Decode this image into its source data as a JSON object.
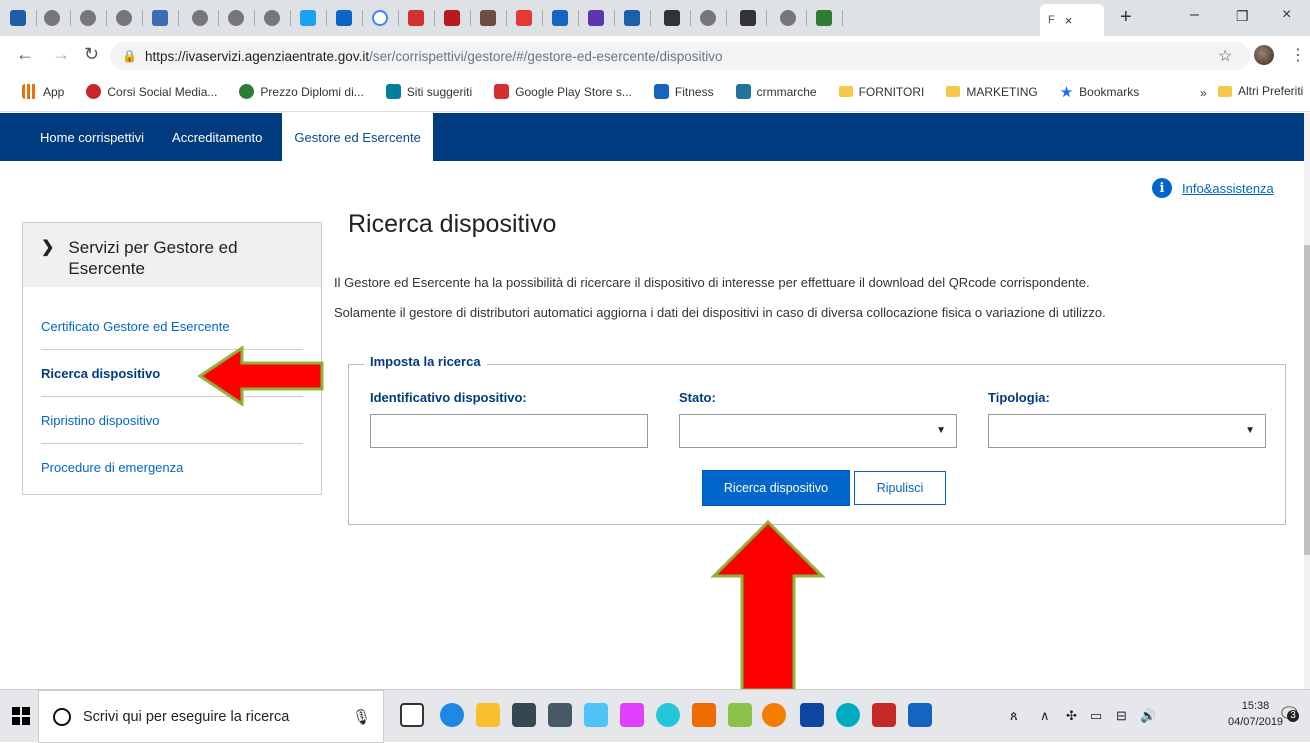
{
  "browser": {
    "active_tab_label": "F",
    "new_tab": "+",
    "window_controls": [
      "–",
      "❐",
      "×"
    ],
    "url_host": "https://ivaservizi.agenziaentrate.gov.it",
    "url_path": "/ser/corrispettivi/gestore/#/gestore-ed-esercente/dispositivo",
    "bookmarks": [
      {
        "label": "App",
        "icon": "apps-grid-icon",
        "color": "#e8710a"
      },
      {
        "label": "Corsi Social Media...",
        "icon": "bookmark-favicon-icon",
        "color": "#c62828"
      },
      {
        "label": "Prezzo Diplomi di...",
        "icon": "bookmark-favicon-icon",
        "color": "#2e7d32"
      },
      {
        "label": "Siti suggeriti",
        "icon": "bing-icon",
        "color": "#00809d"
      },
      {
        "label": "Google Play Store s...",
        "icon": "bookmark-favicon-icon",
        "color": "#d32f2f"
      },
      {
        "label": "Fitness",
        "icon": "cross-icon",
        "color": "#1565c0"
      },
      {
        "label": "crmmarche",
        "icon": "wp-icon",
        "color": "#21759b"
      },
      {
        "label": "FORNITORI",
        "icon": "folder-icon",
        "color": "#f6c84a"
      },
      {
        "label": "MARKETING",
        "icon": "folder-icon",
        "color": "#f6c84a"
      },
      {
        "label": "Bookmarks",
        "icon": "star-icon",
        "color": "#1a73e8"
      }
    ],
    "bookmarks_more": "»",
    "bookmarks_other": "Altri Preferiti"
  },
  "site_nav": {
    "items": [
      {
        "label": "Home corrispettivi",
        "active": false
      },
      {
        "label": "Accreditamento",
        "active": false
      },
      {
        "label": "Gestore ed Esercente",
        "active": true
      }
    ]
  },
  "info_link": "Info&assistenza",
  "sidebar": {
    "title": "Servizi per Gestore ed Esercente",
    "items": [
      {
        "label": "Certificato Gestore ed Esercente",
        "active": false
      },
      {
        "label": "Ricerca dispositivo",
        "active": true
      },
      {
        "label": "Ripristino dispositivo",
        "active": false
      },
      {
        "label": "Procedure di emergenza",
        "active": false
      }
    ]
  },
  "main": {
    "title": "Ricerca dispositivo",
    "desc1": "Il Gestore ed Esercente ha la possibilità di ricercare il dispositivo di interesse per effettuare il download del QRcode corrispondente.",
    "desc2": "Solamente il gestore di distributori automatici aggiorna i dati dei dispositivi in caso di diversa collocazione fisica o variazione di utilizzo.",
    "form": {
      "legend": "Imposta la ricerca",
      "id_label": "Identificativo dispositivo:",
      "id_value": "",
      "stato_label": "Stato:",
      "stato_value": "",
      "tipologia_label": "Tipologia:",
      "tipologia_value": "",
      "search_button": "Ricerca dispositivo",
      "reset_button": "Ripulisci"
    }
  },
  "taskbar": {
    "search_placeholder": "Scrivi qui per eseguire la ricerca",
    "time": "15:38",
    "date": "04/07/2019",
    "notifications": "3"
  },
  "colors": {
    "nav_bg": "#003b80",
    "link": "#0066cc",
    "arrow": "#ff0000",
    "arrow_outline": "#8db33a"
  }
}
